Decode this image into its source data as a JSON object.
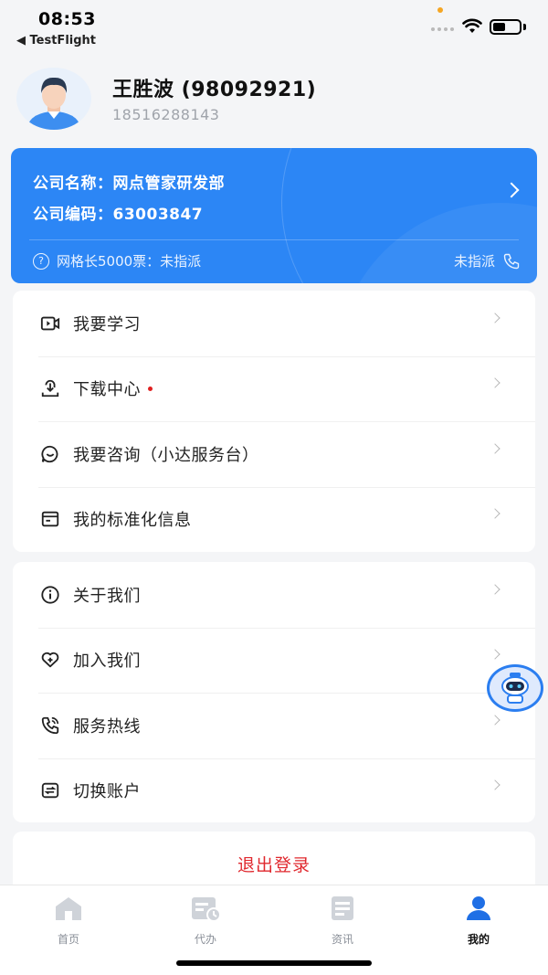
{
  "status_bar": {
    "time": "08:53",
    "back_app": "◀ TestFlight"
  },
  "profile": {
    "name": "王胜波 (98092921)",
    "phone": "18516288143"
  },
  "company": {
    "name_line": "公司名称：网点管家研发部",
    "code_line": "公司编码：63003847",
    "grid_line": "网格长5000票：未指派",
    "right_status": "未指派"
  },
  "menu_group1": [
    {
      "label": "我要学习",
      "icon": "video-icon"
    },
    {
      "label": "下载中心",
      "icon": "download-icon",
      "badge": true
    },
    {
      "label": "我要咨询（小达服务台）",
      "icon": "chat-icon"
    },
    {
      "label": "我的标准化信息",
      "icon": "card-icon"
    }
  ],
  "menu_group2": [
    {
      "label": "关于我们",
      "icon": "info-icon"
    },
    {
      "label": "加入我们",
      "icon": "heart-plus-icon"
    },
    {
      "label": "服务热线",
      "icon": "phone-icon"
    },
    {
      "label": "切换账户",
      "icon": "switch-icon"
    }
  ],
  "logout_label": "退出登录",
  "tabs": [
    {
      "label": "首页",
      "icon": "home-icon",
      "active": false
    },
    {
      "label": "代办",
      "icon": "todo-icon",
      "active": false
    },
    {
      "label": "资讯",
      "icon": "news-icon",
      "active": false
    },
    {
      "label": "我的",
      "icon": "user-icon",
      "active": true
    }
  ],
  "colors": {
    "accent": "#2c86f5",
    "danger": "#e0282e",
    "background": "#f4f5f7"
  }
}
